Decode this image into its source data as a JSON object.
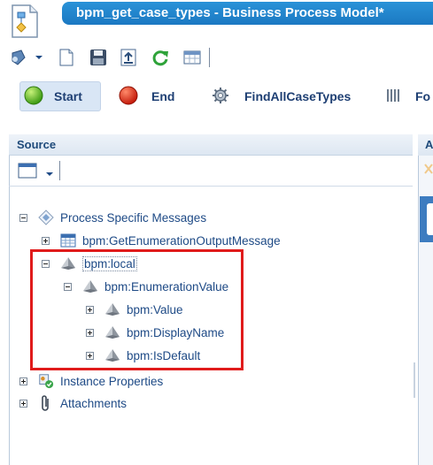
{
  "window": {
    "title": "bpm_get_case_types - Business Process Model*"
  },
  "toolbar": {
    "icons": [
      "process-menu-icon",
      "dropdown-arrow-icon",
      "new-document-icon",
      "save-icon",
      "export-icon",
      "refresh-icon",
      "grid-icon"
    ]
  },
  "palette": {
    "items": [
      {
        "label": "Start",
        "icon": "start-green-circle-icon"
      },
      {
        "label": "End",
        "icon": "end-red-circle-icon"
      },
      {
        "label": "FindAllCaseTypes",
        "icon": "gear-activity-icon"
      },
      {
        "label": "Fo",
        "icon": "form-bars-icon"
      }
    ]
  },
  "source": {
    "title": "Source",
    "tree": [
      {
        "label": "Process Specific Messages",
        "state": "expanded"
      },
      {
        "label": "bpm:GetEnumerationOutputMessage",
        "state": "collapsed"
      },
      {
        "label": "bpm:local",
        "state": "expanded"
      },
      {
        "label": "bpm:EnumerationValue",
        "state": "expanded"
      },
      {
        "label": "bpm:Value",
        "state": "collapsed"
      },
      {
        "label": "bpm:DisplayName",
        "state": "collapsed"
      },
      {
        "label": "bpm:IsDefault",
        "state": "collapsed"
      },
      {
        "label": "Instance Properties",
        "state": "collapsed"
      },
      {
        "label": "Attachments",
        "state": "collapsed"
      }
    ]
  },
  "right_panel": {
    "title": "A"
  },
  "colors": {
    "title_bar": "#1b78c2",
    "highlight": "#e01b1b",
    "tree_text": "#1e4a86"
  }
}
